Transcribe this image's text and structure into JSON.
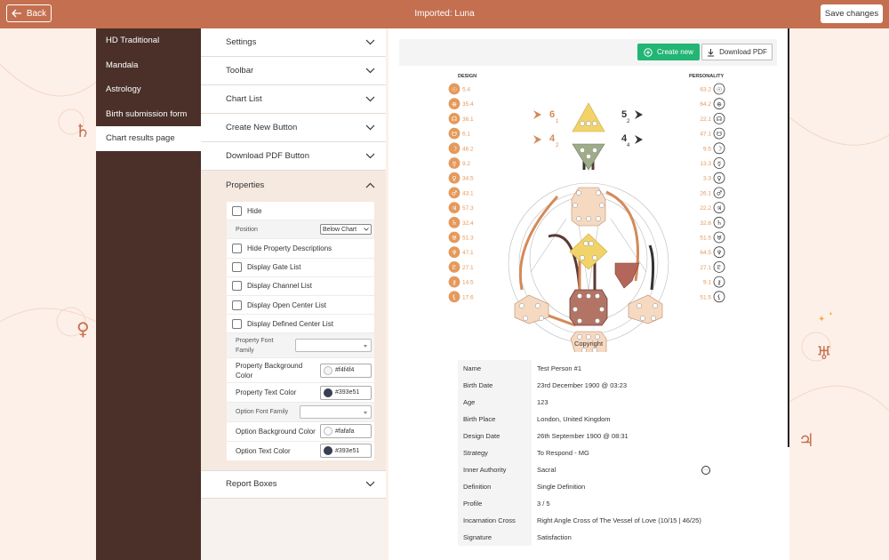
{
  "topbar": {
    "back_label": "Back",
    "title": "Imported: Luna",
    "save_label": "Save changes",
    "color": "#c46f4f"
  },
  "sidebar": {
    "items": [
      {
        "label": "HD Traditional",
        "active": false
      },
      {
        "label": "Mandala",
        "active": false
      },
      {
        "label": "Astrology",
        "active": false
      },
      {
        "label": "Birth submission form",
        "active": false
      },
      {
        "label": "Chart results page",
        "active": true
      }
    ]
  },
  "settings": {
    "sections": [
      "Settings",
      "Toolbar",
      "Chart List",
      "Create New Button",
      "Download PDF Button",
      "Properties",
      "Report Boxes"
    ],
    "properties": {
      "hide": "Hide",
      "position_label": "Position",
      "position_value": "Below Chart",
      "hide_desc": "Hide Property Descriptions",
      "display_gate": "Display Gate List",
      "display_channel": "Display Channel List",
      "display_open": "Display Open Center List",
      "display_defined": "Display Defined Center List",
      "prop_font_family": "Property Font Family",
      "prop_bg_color_label": "Property Background Color",
      "prop_bg_color": "#f4f4f4",
      "prop_text_color_label": "Property Text Color",
      "prop_text_color": "#393e51",
      "opt_font_family": "Option Font Family",
      "opt_bg_color_label": "Option Background Color",
      "opt_bg_color": "#fafafa",
      "opt_text_color_label": "Option Text Color",
      "opt_text_color": "#393e51"
    }
  },
  "preview": {
    "create_label": "Create new",
    "download_label": "Download PDF",
    "design_label": "DESIGN",
    "personality_label": "PERSONALITY",
    "copyright": "Copyright",
    "design_values": [
      "5.4",
      "35.4",
      "36.1",
      "6.1",
      "46.2",
      "9.2",
      "34.5",
      "43.1",
      "57.3",
      "32.4",
      "51.3",
      "47.1",
      "27.1",
      "14.5",
      "17.6"
    ],
    "personality_values": [
      "63.2",
      "64.2",
      "22.1",
      "47.1",
      "9.5",
      "13.3",
      "3.3",
      "26.1",
      "22.2",
      "32.6",
      "51.5",
      "64.5",
      "27.1",
      "9.1",
      "51.5"
    ],
    "arrows_left": [
      {
        "big": "6",
        "small": "1"
      },
      {
        "big": "4",
        "small": "2"
      }
    ],
    "arrows_right": [
      {
        "big": "5",
        "small": "2"
      },
      {
        "big": "4",
        "small": "4"
      }
    ],
    "table": [
      {
        "key": "Name",
        "value": "Test Person #1"
      },
      {
        "key": "Birth Date",
        "value": "23rd December 1900 @ 03:23"
      },
      {
        "key": "Age",
        "value": "123"
      },
      {
        "key": "Birth Place",
        "value": "London, United Kingdom"
      },
      {
        "key": "Design Date",
        "value": "26th September 1900 @ 08:31"
      },
      {
        "key": "Strategy",
        "value": "To Respond - MG"
      },
      {
        "key": "Inner Authority",
        "value": "Sacral"
      },
      {
        "key": "Definition",
        "value": "Single Definition"
      },
      {
        "key": "Profile",
        "value": "3 / 5"
      },
      {
        "key": "Incarnation Cross",
        "value": "Right Angle Cross of The Vessel of Love (10/15 | 46/25)"
      },
      {
        "key": "Signature",
        "value": "Satisfaction"
      }
    ]
  }
}
